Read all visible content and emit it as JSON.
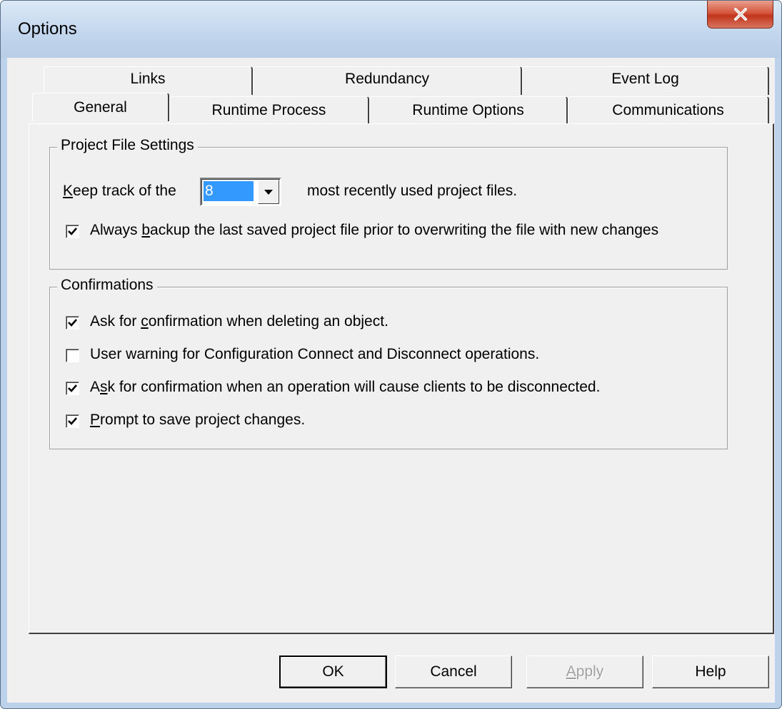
{
  "window": {
    "title": "Options"
  },
  "tabs": {
    "back_row": [
      "Links",
      "Redundancy",
      "Event Log"
    ],
    "front_row": [
      "General",
      "Runtime Process",
      "Runtime Options",
      "Communications"
    ],
    "active": "General"
  },
  "project_file_settings": {
    "legend": "Project File Settings",
    "keep_track_prefix_key": "K",
    "keep_track_prefix_rest": "eep track of the",
    "recent_count_value": "8",
    "keep_track_suffix": "most recently used project files.",
    "backup": {
      "checked": true,
      "label_before": "Always ",
      "label_key": "b",
      "label_after": "ackup the last saved project file prior to overwriting the file with new changes"
    }
  },
  "confirmations": {
    "legend": "Confirmations",
    "items": [
      {
        "checked": true,
        "label_before": "Ask for ",
        "label_key": "c",
        "label_after": "onfirmation when deleting an object."
      },
      {
        "checked": false,
        "label_before": "User warning for Configuration Connect and Disconnect operations.",
        "label_key": "",
        "label_after": ""
      },
      {
        "checked": true,
        "label_before": "A",
        "label_key": "s",
        "label_after": "k for confirmation when an operation will cause clients to be disconnected."
      },
      {
        "checked": true,
        "label_before": "",
        "label_key": "P",
        "label_after": "rompt to save project changes."
      }
    ]
  },
  "buttons": {
    "ok": "OK",
    "cancel": "Cancel",
    "apply_key": "A",
    "apply_rest": "pply",
    "help": "Help"
  },
  "icons": {
    "close": "close-x-icon",
    "dropdown": "dropdown-arrow-icon",
    "check": "checkmark-icon"
  }
}
